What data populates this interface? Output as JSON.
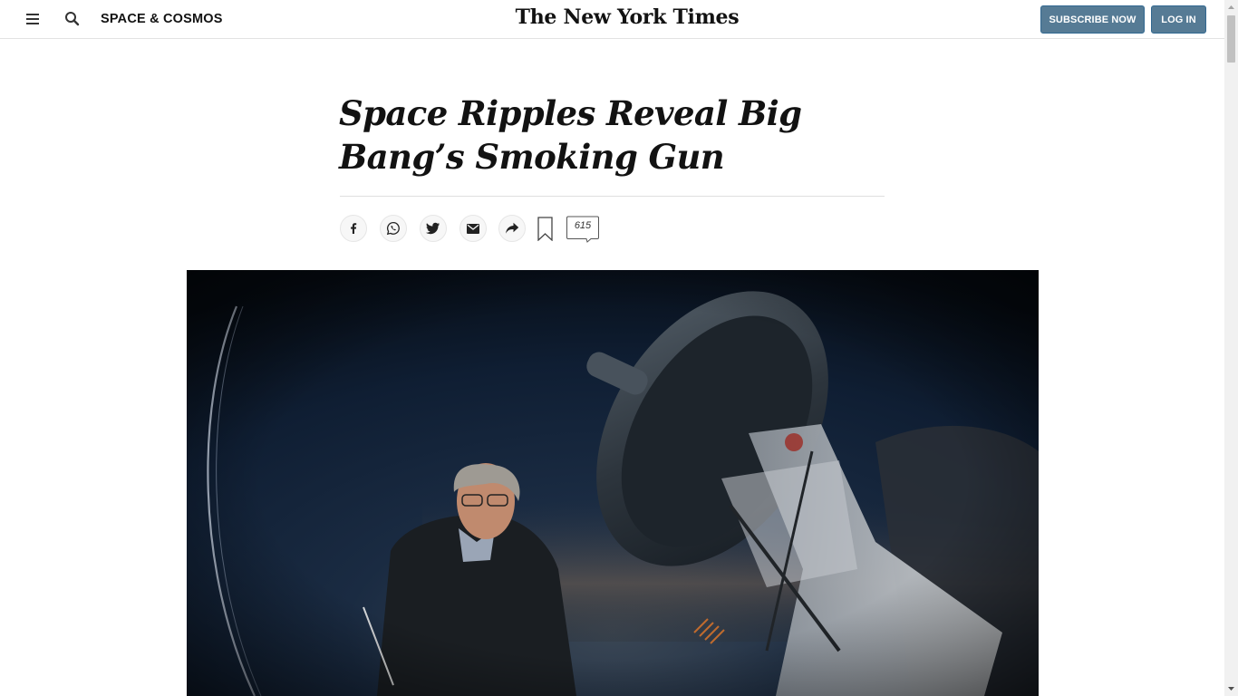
{
  "header": {
    "section_label": "SPACE & COSMOS",
    "masthead": "The New York Times",
    "subscribe_label": "SUBSCRIBE NOW",
    "login_label": "LOG IN"
  },
  "article": {
    "headline": "Space Ripples Reveal Big Bang’s Smoking Gun"
  },
  "share_tools": {
    "items": [
      "facebook-icon",
      "whatsapp-icon",
      "twitter-icon",
      "email-icon",
      "share-icon",
      "bookmark-icon"
    ],
    "comment_count": "615"
  },
  "colors": {
    "button_bg": "#567b95",
    "button_border": "#326891",
    "text": "#121212"
  }
}
